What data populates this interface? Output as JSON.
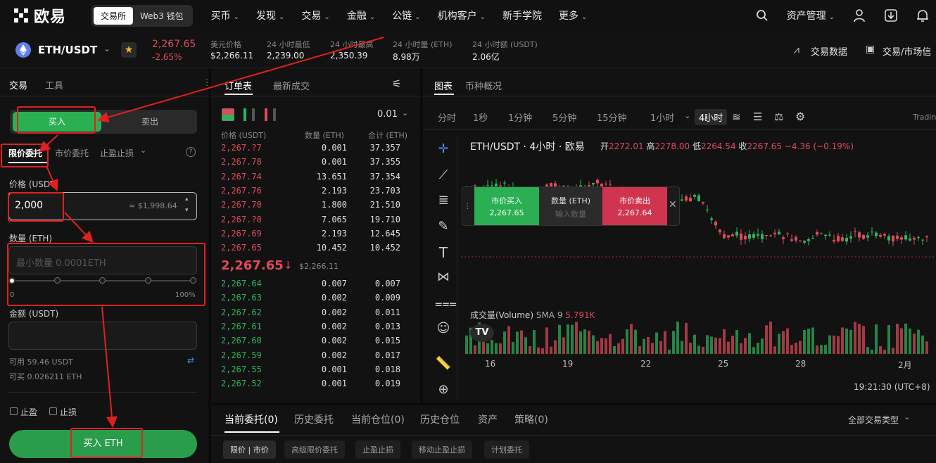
{
  "nav": {
    "logo_text": "欧易",
    "mode_tabs": [
      "交易所",
      "Web3 钱包"
    ],
    "items": [
      "买币",
      "发现",
      "交易",
      "金融",
      "公链",
      "机构客户",
      "新手学院",
      "更多"
    ],
    "asset_mgmt": "资产管理"
  },
  "ticker": {
    "pair": "ETH/USDT",
    "last_price": "2,267.65",
    "change_pct": "-2.65%",
    "usd_price_label": "美元价格",
    "usd_price": "$2,266.11",
    "low_label": "24 小时最低",
    "low": "2,239.00",
    "high_label": "24 小时最高",
    "high": "2,350.39",
    "vol_eth_label": "24 小时量 (ETH)",
    "vol_eth": "8.98万",
    "vol_usdt_label": "24 小时额 (USDT)",
    "vol_usdt": "2.06亿",
    "trade_data": "交易数据",
    "trade_market": "交易/市场信"
  },
  "trade_panel": {
    "tabs": [
      "交易",
      "工具"
    ],
    "buy": "买入",
    "sell": "卖出",
    "order_types": [
      "限价委托",
      "市价委托",
      "止盈止损"
    ],
    "price_label": "价格 (USDT)",
    "price_value": "2,000",
    "price_equiv": "≈ $1,998.64",
    "qty_label": "数量 (ETH)",
    "qty_placeholder": "最小数量 0.0001ETH",
    "slider_min": "0",
    "slider_max": "100%",
    "amount_label": "金额 (USDT)",
    "available": "可用 59.46 USDT",
    "can_buy": "可买 0.026211 ETH",
    "take_profit": "止盈",
    "stop_loss": "止损",
    "submit": "买入 ETH"
  },
  "orderbook": {
    "tabs": [
      "订单表",
      "最新成交"
    ],
    "precision": "0.01",
    "headers": [
      "价格 (USDT)",
      "数量 (ETH)",
      "合计 (ETH)"
    ],
    "asks": [
      [
        "2,267.?7",
        "0.001",
        "37.357"
      ],
      [
        "2,267.78",
        "0.001",
        "37.355"
      ],
      [
        "2,267.74",
        "13.651",
        "37.354"
      ],
      [
        "2,267.76",
        "2.193",
        "23.703"
      ],
      [
        "2,267.70",
        "1.800",
        "21.510"
      ],
      [
        "2,267.?0",
        "7.065",
        "19.710"
      ],
      [
        "2,267.69",
        "2.193",
        "12.645"
      ],
      [
        "2,267.65",
        "10.452",
        "10.452"
      ]
    ],
    "mid_price": "2,267.65",
    "mid_usd": "$2,266.11",
    "bids": [
      [
        "2,267.64",
        "0.007",
        "0.007"
      ],
      [
        "2,267.63",
        "0.002",
        "0.009"
      ],
      [
        "2,267.62",
        "0.002",
        "0.011"
      ],
      [
        "2,267.61",
        "0.002",
        "0.013"
      ],
      [
        "2,267.60",
        "0.002",
        "0.015"
      ],
      [
        "2,267.59",
        "0.002",
        "0.017"
      ],
      [
        "2,267.55",
        "0.001",
        "0.018"
      ],
      [
        "2,267.52",
        "0.001",
        "0.019"
      ]
    ]
  },
  "chart": {
    "tabs": [
      "图表",
      "币种概况"
    ],
    "intervals": [
      "分时",
      "1秒",
      "1分钟",
      "5分钟",
      "15分钟",
      "1小时",
      "4小时"
    ],
    "trading_label": "Tradin",
    "title": "ETH/USDT · 4小时 · 欧易",
    "ohlc": "开=2272.01 高=2278.00 低=2264.54 收=2267.65 −4.36 (−0.19%)",
    "ohlc_parts": {
      "o_label": "开",
      "o": "2272.01",
      "h_label": "高",
      "h": "2278.00",
      "l_label": "低",
      "l": "2264.54",
      "c_label": "收",
      "c": "2267.65",
      "chg": "−4.36 (−0.19%)"
    },
    "quick_buy_label": "市价买入",
    "quick_buy_price": "2,267.65",
    "quick_qty_label": "数量 (ETH)",
    "quick_qty_placeholder": "输入数量",
    "quick_sell_label": "市价卖出",
    "quick_sell_price": "2,267.64",
    "volume_label": "成交量(Volume)",
    "sma_label": "SMA 9",
    "sma_value": "5.791K",
    "x_ticks": [
      "16",
      "19",
      "22",
      "25",
      "28",
      "2月"
    ],
    "time": "19:21:30 (UTC+8)"
  },
  "bottom": {
    "tabs": [
      "当前委托(0)",
      "历史委托",
      "当前仓位(0)",
      "历史仓位",
      "资产",
      "策略(0)"
    ],
    "filter": "全部交易类型",
    "sub": [
      "限价 | 市价",
      "高级限价委托",
      "止盈止损",
      "移动止盈止损",
      "计划委托"
    ]
  },
  "colors": {
    "buy": "#2db55d",
    "sell": "#e04a5a",
    "highlight": "#e02020"
  }
}
